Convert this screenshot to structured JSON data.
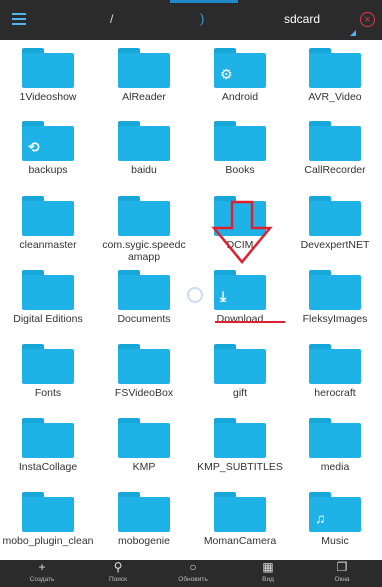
{
  "toolbar": {
    "root_path": "/",
    "separator": ")",
    "current_folder": "sdcard",
    "close_symbol": "⊗"
  },
  "folders": [
    {
      "name": "1Videoshow",
      "overlay": ""
    },
    {
      "name": "AlReader",
      "overlay": ""
    },
    {
      "name": "Android",
      "overlay": "gear"
    },
    {
      "name": "AVR_Video",
      "overlay": ""
    },
    {
      "name": "backups",
      "overlay": "backup"
    },
    {
      "name": "baidu",
      "overlay": ""
    },
    {
      "name": "Books",
      "overlay": ""
    },
    {
      "name": "CallRecorder",
      "overlay": ""
    },
    {
      "name": "cleanmaster",
      "overlay": ""
    },
    {
      "name": "com.sygic.speedcamapp",
      "overlay": ""
    },
    {
      "name": "DCIM",
      "overlay": "camera"
    },
    {
      "name": "DevexpertNET",
      "overlay": ""
    },
    {
      "name": "Digital Editions",
      "overlay": ""
    },
    {
      "name": "Documents",
      "overlay": ""
    },
    {
      "name": "Download",
      "overlay": "download"
    },
    {
      "name": "FleksyImages",
      "overlay": ""
    },
    {
      "name": "Fonts",
      "overlay": ""
    },
    {
      "name": "FSVideoBox",
      "overlay": ""
    },
    {
      "name": "gift",
      "overlay": ""
    },
    {
      "name": "herocraft",
      "overlay": ""
    },
    {
      "name": "InstaCollage",
      "overlay": ""
    },
    {
      "name": "KMP",
      "overlay": ""
    },
    {
      "name": "KMP_SUBTITLES",
      "overlay": ""
    },
    {
      "name": "media",
      "overlay": ""
    },
    {
      "name": "mobo_plugin_clean",
      "overlay": ""
    },
    {
      "name": "mobogenie",
      "overlay": ""
    },
    {
      "name": "MomanCamera",
      "overlay": ""
    },
    {
      "name": "Music",
      "overlay": "music"
    }
  ],
  "labels": {
    "r0": [
      "1Videoshow",
      "AlReader",
      "Android",
      "AVR_Video"
    ],
    "r1": [
      "backups",
      "baidu",
      "Books",
      "CallRecorder"
    ],
    "r2": [
      "cleanmaster",
      "com.sygic.speedc amapp",
      "DCIM",
      "DevexpertNET"
    ],
    "r3": [
      "Digital Editions",
      "Documents",
      "Download",
      "FleksyImages"
    ],
    "r4": [
      "Fonts",
      "FSVideoBox",
      "gift",
      "herocraft"
    ],
    "r5": [
      "InstaCollage",
      "KMP",
      "KMP_SUBTITLES",
      "media"
    ],
    "r6": [
      "mobo_plugin_clean",
      "mobogenie",
      "MomanCamera",
      "Music"
    ]
  },
  "bottom_bar": [
    {
      "label": "Создать",
      "icon": "plus-icon",
      "glyph": "+"
    },
    {
      "label": "Поиск",
      "icon": "search-icon",
      "glyph": "⚲"
    },
    {
      "label": "Обновить",
      "icon": "refresh-icon",
      "glyph": "○"
    },
    {
      "label": "Вид",
      "icon": "grid-view-icon",
      "glyph": "▦"
    },
    {
      "label": "Окна",
      "icon": "windows-icon",
      "glyph": "❐"
    }
  ],
  "colors": {
    "folder": "#1fb2e6",
    "bar_background": "#2b2b2b",
    "accent": "#4fb3f0",
    "highlight_red": "#e0202e"
  }
}
